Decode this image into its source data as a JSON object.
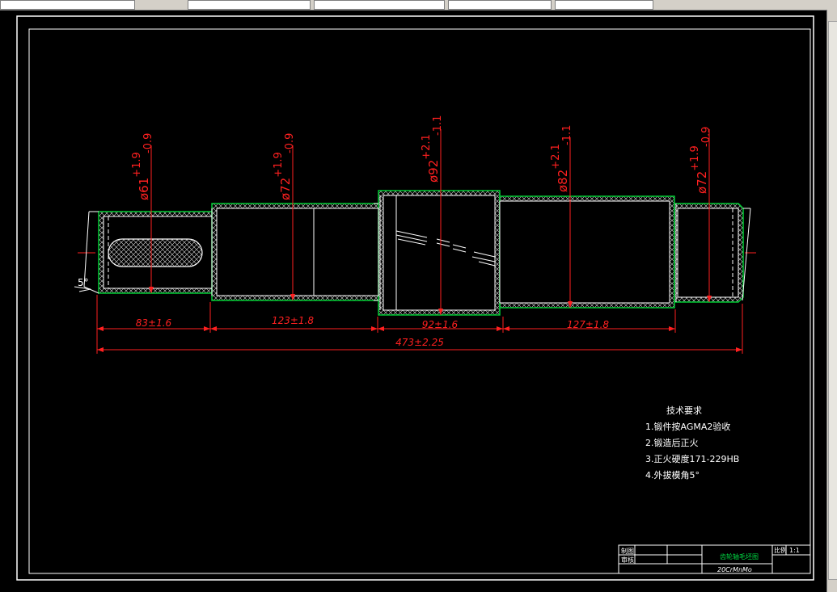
{
  "toolbar": {
    "fields": [
      "",
      "",
      "",
      "",
      "",
      ""
    ]
  },
  "drawing": {
    "diameters": [
      {
        "base": "ø61",
        "upper": "+1.9",
        "lower": "-0.9"
      },
      {
        "base": "ø72",
        "upper": "+1.9",
        "lower": "-0.9"
      },
      {
        "base": "ø92",
        "upper": "+2.1",
        "lower": "-1.1"
      },
      {
        "base": "ø82",
        "upper": "+2.1",
        "lower": "-1.1"
      },
      {
        "base": "ø72",
        "upper": "+1.9",
        "lower": "-0.9"
      }
    ],
    "lengths": [
      "83±1.6",
      "123±1.8",
      "92±1.6",
      "127±1.8"
    ],
    "total_length": "473±2.25",
    "chamfer_label": "5°",
    "notes": {
      "title": "技术要求",
      "items": [
        "1.锻件按AGMA2验收",
        "2.锻造后正火",
        "3.正火硬度171-229HB",
        "4.外拔模角5°"
      ]
    },
    "title_block": {
      "drawn_label": "制图",
      "checked_label": "审核",
      "part_name": "齿轮轴毛坯图",
      "scale_label": "比例",
      "scale_value": "1:1",
      "material": "20CrMnMo"
    },
    "colors": {
      "background": "#000000",
      "outline": "#ffffff",
      "hatch_green": "#00cc33",
      "dimension_red": "#ff2020",
      "text_white": "#ffffff",
      "title_green": "#00dd44"
    }
  }
}
